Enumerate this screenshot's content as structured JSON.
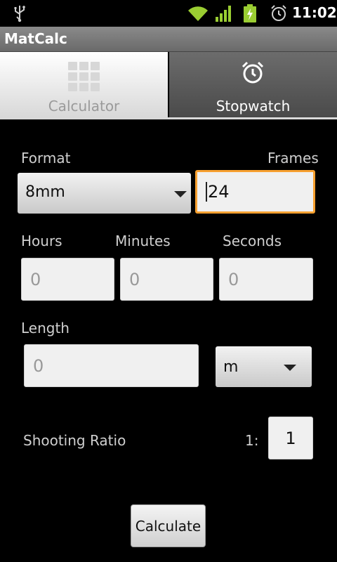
{
  "status_bar": {
    "time": "11:02",
    "icons": [
      "usb-icon",
      "wifi-icon",
      "signal-icon",
      "battery-charging-icon",
      "alarm-icon"
    ]
  },
  "app": {
    "title": "MatCalc"
  },
  "tabs": [
    {
      "label": "Calculator",
      "icon": "calculator-grid-icon",
      "selected": true
    },
    {
      "label": "Stopwatch",
      "icon": "alarm-clock-icon",
      "selected": false
    }
  ],
  "form": {
    "format_label": "Format",
    "format_value": "8mm",
    "frames_label": "Frames",
    "frames_value": "24",
    "hours_label": "Hours",
    "hours_placeholder": "0",
    "minutes_label": "Minutes",
    "minutes_placeholder": "0",
    "seconds_label": "Seconds",
    "seconds_placeholder": "0",
    "length_label": "Length",
    "length_placeholder": "0",
    "unit_value": "m",
    "ratio_label": "Shooting Ratio",
    "ratio_prefix": "1:",
    "ratio_value": "1",
    "calculate_label": "Calculate"
  },
  "colors": {
    "focus_border": "#f7a030",
    "background": "#000000"
  }
}
